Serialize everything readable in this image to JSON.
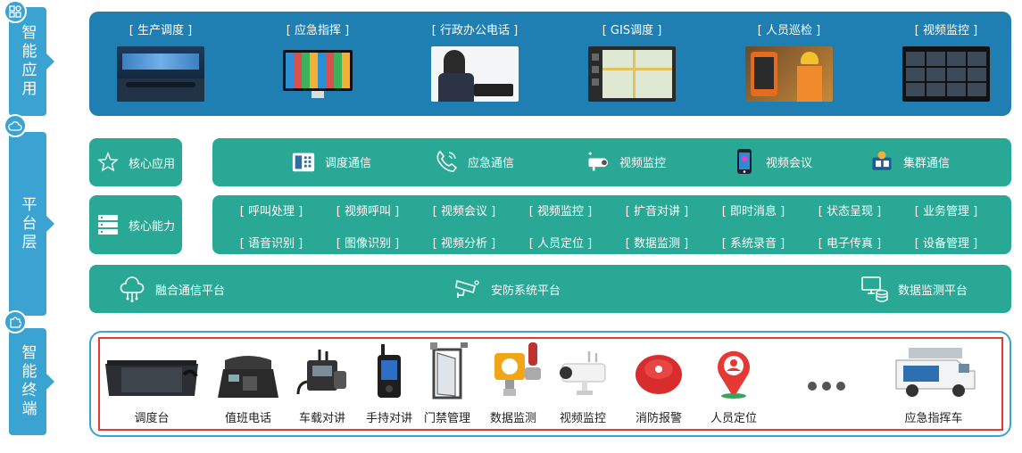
{
  "side_labels": {
    "apps": "智能应用",
    "platform": "平台层",
    "terminals": "智能终端"
  },
  "apps": [
    {
      "label": "[ 生产调度 ]",
      "thumb": "control-room"
    },
    {
      "label": "[ 应急指挥 ]",
      "thumb": "monitor-tiles"
    },
    {
      "label": "[ 行政办公电话 ]",
      "thumb": "office-phone"
    },
    {
      "label": "[ GIS调度 ]",
      "thumb": "gis-map"
    },
    {
      "label": "[ 人员巡检 ]",
      "thumb": "worker-tablet"
    },
    {
      "label": "[ 视频监控 ]",
      "thumb": "video-wall"
    }
  ],
  "core_app": {
    "title": "核心应用",
    "items": [
      "调度通信",
      "应急通信",
      "视频监控",
      "视频会议",
      "集群通信"
    ]
  },
  "core_capability": {
    "title": "核心能力",
    "row1": [
      "[ 呼叫处理 ]",
      "[ 视频呼叫 ]",
      "[ 视频会议 ]",
      "[ 视频监控 ]",
      "[ 扩音对讲 ]",
      "[ 即时消息 ]",
      "[ 状态呈现 ]",
      "[ 业务管理 ]"
    ],
    "row2": [
      "[ 语音识别 ]",
      "[ 图像识别 ]",
      "[ 视频分析 ]",
      "[ 人员定位 ]",
      "[ 数据监测 ]",
      "[ 系统录音 ]",
      "[ 电子传真 ]",
      "[ 设备管理 ]"
    ]
  },
  "platforms": [
    "融合通信平台",
    "安防系统平台",
    "数据监测平台"
  ],
  "terminals": [
    "调度台",
    "值班电话",
    "车载对讲",
    "手持对讲",
    "门禁管理",
    "数据监测",
    "视频监控",
    "消防报警",
    "人员定位",
    "应急指挥车"
  ],
  "colors": {
    "side": "#3aa3d1",
    "app_panel": "#1f7fb3",
    "platform": "#29a895",
    "highlight_border": "#e53935"
  }
}
